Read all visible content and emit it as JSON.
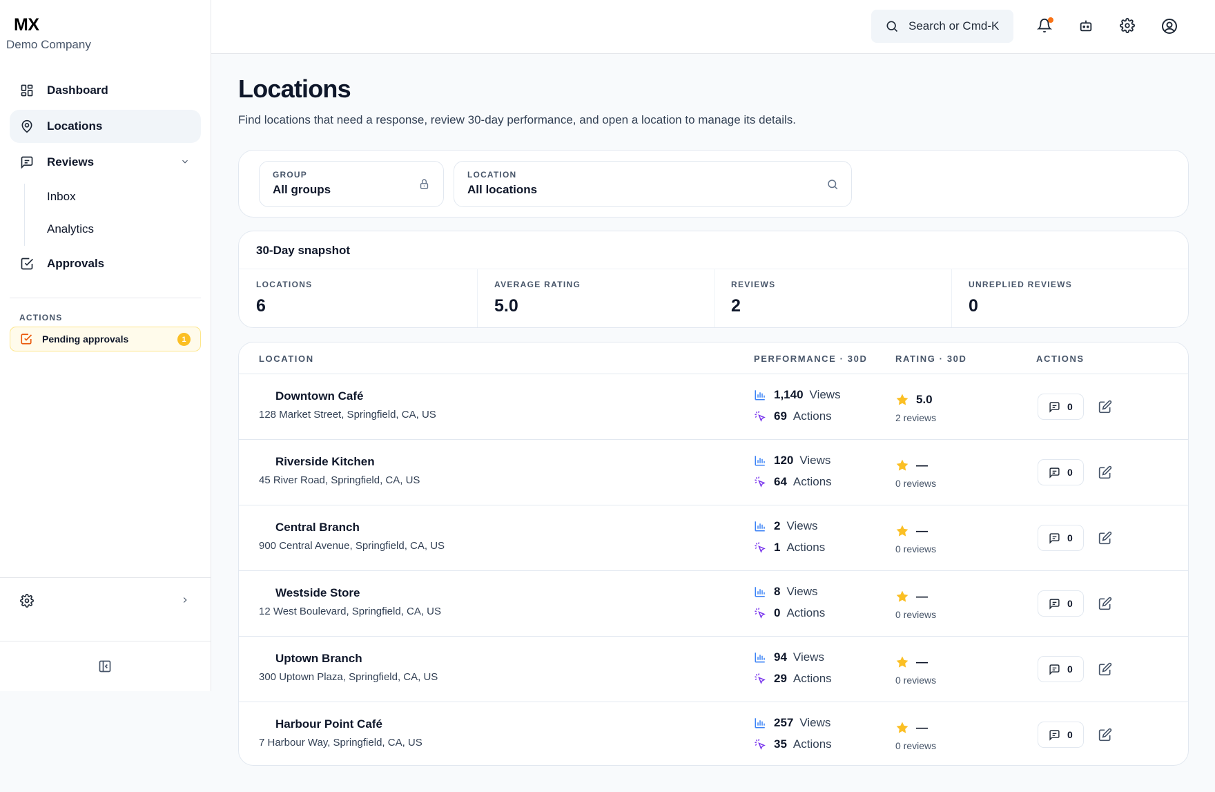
{
  "sidebar": {
    "brand": "MX",
    "company": "Demo Company",
    "nav": {
      "dashboard": "Dashboard",
      "locations": "Locations",
      "reviews": "Reviews",
      "inbox": "Inbox",
      "analytics": "Analytics",
      "approvals": "Approvals"
    },
    "actions_label": "ACTIONS",
    "pending_label": "Pending approvals",
    "pending_count": "1",
    "settings": "Settings"
  },
  "topbar": {
    "search_placeholder": "Search or Cmd-K"
  },
  "page": {
    "title": "Locations",
    "subtitle": "Find locations that need a response, review 30-day performance, and open a location to manage its details."
  },
  "filters": {
    "group": {
      "label": "GROUP",
      "value": "All groups"
    },
    "location": {
      "label": "LOCATION",
      "value": "All locations"
    }
  },
  "snapshot": {
    "title": "30-Day snapshot",
    "stats": [
      {
        "label": "LOCATIONS",
        "value": "6"
      },
      {
        "label": "AVERAGE RATING",
        "value": "5.0"
      },
      {
        "label": "REVIEWS",
        "value": "2"
      },
      {
        "label": "UNREPLIED REVIEWS",
        "value": "0"
      }
    ]
  },
  "table": {
    "headers": {
      "location": "LOCATION",
      "performance": "PERFORMANCE · 30D",
      "rating": "RATING · 30D",
      "actions": "ACTIONS"
    },
    "views_label": "Views",
    "actions_label": "Actions",
    "rows": [
      {
        "name": "Downtown Café",
        "address": "128 Market Street, Springfield, CA, US",
        "views": "1,140",
        "actions": "69",
        "rating": "5.0",
        "reviews": "2 reviews",
        "unreplied": "0"
      },
      {
        "name": "Riverside Kitchen",
        "address": "45 River Road, Springfield, CA, US",
        "views": "120",
        "actions": "64",
        "rating": "—",
        "reviews": "0 reviews",
        "unreplied": "0"
      },
      {
        "name": "Central Branch",
        "address": "900 Central Avenue, Springfield, CA, US",
        "views": "2",
        "actions": "1",
        "rating": "—",
        "reviews": "0 reviews",
        "unreplied": "0"
      },
      {
        "name": "Westside Store",
        "address": "12 West Boulevard, Springfield, CA, US",
        "views": "8",
        "actions": "0",
        "rating": "—",
        "reviews": "0 reviews",
        "unreplied": "0"
      },
      {
        "name": "Uptown Branch",
        "address": "300 Uptown Plaza, Springfield, CA, US",
        "views": "94",
        "actions": "29",
        "rating": "—",
        "reviews": "0 reviews",
        "unreplied": "0"
      },
      {
        "name": "Harbour Point Café",
        "address": "7 Harbour Way, Springfield, CA, US",
        "views": "257",
        "actions": "35",
        "rating": "—",
        "reviews": "0 reviews",
        "unreplied": "0"
      }
    ]
  },
  "icons": {
    "dashboard": "grid-icon",
    "locations": "map-pin-icon",
    "reviews": "message-icon",
    "approvals": "check-square-icon",
    "settings": "gear-icon",
    "views": "bar-chart-icon",
    "actions": "click-icon",
    "rating": "star-icon",
    "reply": "message-icon",
    "edit": "edit-icon"
  },
  "colors": {
    "accent_orange": "#f97316",
    "star": "#fbbf24",
    "views_icon": "#3b82f6",
    "actions_icon": "#7c3aed",
    "pending_bg": "#fffbeb"
  }
}
